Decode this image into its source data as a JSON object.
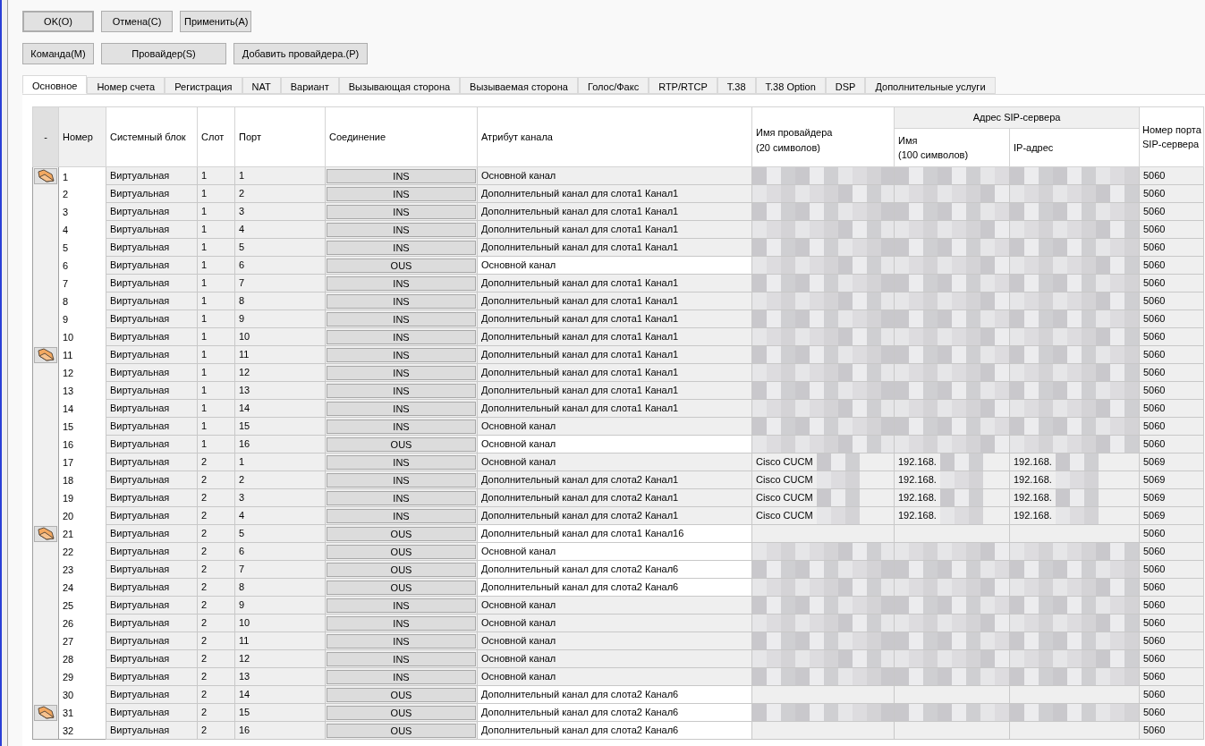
{
  "buttons_top": [
    {
      "label": "OK(O)",
      "default": true
    },
    {
      "label": "Отмена(C)",
      "default": false
    },
    {
      "label": "Применить(A)",
      "default": false
    }
  ],
  "buttons_second": [
    {
      "label": "Команда(M)"
    },
    {
      "label": "Провайдер(S)"
    },
    {
      "label": "Добавить провайдера.(P)"
    }
  ],
  "tabs": [
    {
      "label": "Основное",
      "selected": true
    },
    {
      "label": "Номер счета",
      "selected": false
    },
    {
      "label": "Регистрация",
      "selected": false
    },
    {
      "label": "NAT",
      "selected": false
    },
    {
      "label": "Вариант",
      "selected": false
    },
    {
      "label": "Вызывающая сторона",
      "selected": false
    },
    {
      "label": "Вызываемая сторона",
      "selected": false
    },
    {
      "label": "Голос/Факс",
      "selected": false
    },
    {
      "label": "RTP/RTCP",
      "selected": false
    },
    {
      "label": "T.38",
      "selected": false
    },
    {
      "label": "T.38 Option",
      "selected": false
    },
    {
      "label": "DSP",
      "selected": false
    },
    {
      "label": "Дополнительные услуги",
      "selected": false
    }
  ],
  "table": {
    "columns": [
      "-",
      "Номер",
      "Системный блок",
      "Слот",
      "Порт",
      "Соединение",
      "Атрибут канала",
      "Имя провайдера\n(20 символов)"
    ],
    "group_header": "Адрес SIP-сервера",
    "group_columns": [
      "Имя\n(100 символов)",
      "IP-адрес"
    ],
    "last_column": "Номер порта\nSIP-сервера",
    "rows": [
      {
        "marker": true,
        "number": "1",
        "block": "Виртуальная",
        "slot": "1",
        "port": "1",
        "connection": "INS",
        "attribute": "Основной канал",
        "redacted": true,
        "sip_port": "5060"
      },
      {
        "marker": false,
        "number": "2",
        "block": "Виртуальная",
        "slot": "1",
        "port": "2",
        "connection": "INS",
        "attribute": "Дополнительный канал для слота1 Канал1",
        "redacted": true,
        "sip_port": "5060"
      },
      {
        "marker": false,
        "number": "3",
        "block": "Виртуальная",
        "slot": "1",
        "port": "3",
        "connection": "INS",
        "attribute": "Дополнительный канал для слота1 Канал1",
        "redacted": true,
        "sip_port": "5060"
      },
      {
        "marker": false,
        "number": "4",
        "block": "Виртуальная",
        "slot": "1",
        "port": "4",
        "connection": "INS",
        "attribute": "Дополнительный канал для слота1 Канал1",
        "redacted": true,
        "sip_port": "5060"
      },
      {
        "marker": false,
        "number": "5",
        "block": "Виртуальная",
        "slot": "1",
        "port": "5",
        "connection": "INS",
        "attribute": "Дополнительный канал для слота1 Канал1",
        "redacted": true,
        "sip_port": "5060"
      },
      {
        "marker": false,
        "number": "6",
        "block": "Виртуальная",
        "slot": "1",
        "port": "6",
        "connection": "OUS",
        "attribute": "Основной канал",
        "redacted": true,
        "sip_port": "5060"
      },
      {
        "marker": false,
        "number": "7",
        "block": "Виртуальная",
        "slot": "1",
        "port": "7",
        "connection": "INS",
        "attribute": "Дополнительный канал для слота1 Канал1",
        "redacted": true,
        "sip_port": "5060"
      },
      {
        "marker": false,
        "number": "8",
        "block": "Виртуальная",
        "slot": "1",
        "port": "8",
        "connection": "INS",
        "attribute": "Дополнительный канал для слота1 Канал1",
        "redacted": true,
        "sip_port": "5060"
      },
      {
        "marker": false,
        "number": "9",
        "block": "Виртуальная",
        "slot": "1",
        "port": "9",
        "connection": "INS",
        "attribute": "Дополнительный канал для слота1 Канал1",
        "redacted": true,
        "sip_port": "5060"
      },
      {
        "marker": false,
        "number": "10",
        "block": "Виртуальная",
        "slot": "1",
        "port": "10",
        "connection": "INS",
        "attribute": "Дополнительный канал для слота1 Канал1",
        "redacted": true,
        "sip_port": "5060"
      },
      {
        "marker": true,
        "number": "11",
        "block": "Виртуальная",
        "slot": "1",
        "port": "11",
        "connection": "INS",
        "attribute": "Дополнительный канал для слота1 Канал1",
        "redacted": true,
        "sip_port": "5060"
      },
      {
        "marker": false,
        "number": "12",
        "block": "Виртуальная",
        "slot": "1",
        "port": "12",
        "connection": "INS",
        "attribute": "Дополнительный канал для слота1 Канал1",
        "redacted": true,
        "sip_port": "5060"
      },
      {
        "marker": false,
        "number": "13",
        "block": "Виртуальная",
        "slot": "1",
        "port": "13",
        "connection": "INS",
        "attribute": "Дополнительный канал для слота1 Канал1",
        "redacted": true,
        "sip_port": "5060"
      },
      {
        "marker": false,
        "number": "14",
        "block": "Виртуальная",
        "slot": "1",
        "port": "14",
        "connection": "INS",
        "attribute": "Дополнительный канал для слота1 Канал1",
        "redacted": true,
        "sip_port": "5060"
      },
      {
        "marker": false,
        "number": "15",
        "block": "Виртуальная",
        "slot": "1",
        "port": "15",
        "connection": "INS",
        "attribute": "Основной канал",
        "redacted": true,
        "sip_port": "5060"
      },
      {
        "marker": false,
        "number": "16",
        "block": "Виртуальная",
        "slot": "1",
        "port": "16",
        "connection": "OUS",
        "attribute": "Основной канал",
        "redacted": true,
        "sip_port": "5060"
      },
      {
        "marker": false,
        "number": "17",
        "block": "Виртуальная",
        "slot": "2",
        "port": "1",
        "connection": "INS",
        "attribute": "Основной канал",
        "provider": "Cisco CUCM",
        "sip_name": "192.168.",
        "sip_ip": "192.168.",
        "redacted": true,
        "sip_port": "5069"
      },
      {
        "marker": false,
        "number": "18",
        "block": "Виртуальная",
        "slot": "2",
        "port": "2",
        "connection": "INS",
        "attribute": "Дополнительный канал для слота2 Канал1",
        "provider": "Cisco CUCM",
        "sip_name": "192.168.",
        "sip_ip": "192.168.",
        "redacted": true,
        "sip_port": "5069"
      },
      {
        "marker": false,
        "number": "19",
        "block": "Виртуальная",
        "slot": "2",
        "port": "3",
        "connection": "INS",
        "attribute": "Дополнительный канал для слота2 Канал1",
        "provider": "Cisco CUCM",
        "sip_name": "192.168.",
        "sip_ip": "192.168.",
        "redacted": true,
        "sip_port": "5069"
      },
      {
        "marker": false,
        "number": "20",
        "block": "Виртуальная",
        "slot": "2",
        "port": "4",
        "connection": "INS",
        "attribute": "Дополнительный канал для слота2 Канал1",
        "provider": "Cisco CUCM",
        "sip_name": "192.168.",
        "sip_ip": "192.168.",
        "redacted": true,
        "sip_port": "5069"
      },
      {
        "marker": true,
        "number": "21",
        "block": "Виртуальная",
        "slot": "2",
        "port": "5",
        "connection": "OUS",
        "attribute": "Дополнительный канал для слота1 Канал16",
        "redacted": false,
        "sip_port": "5060"
      },
      {
        "marker": false,
        "number": "22",
        "block": "Виртуальная",
        "slot": "2",
        "port": "6",
        "connection": "OUS",
        "attribute": "Основной канал",
        "redacted": true,
        "sip_port": "5060"
      },
      {
        "marker": false,
        "number": "23",
        "block": "Виртуальная",
        "slot": "2",
        "port": "7",
        "connection": "OUS",
        "attribute": "Дополнительный канал для слота2 Канал6",
        "redacted": true,
        "sip_port": "5060"
      },
      {
        "marker": false,
        "number": "24",
        "block": "Виртуальная",
        "slot": "2",
        "port": "8",
        "connection": "OUS",
        "attribute": "Дополнительный канал для слота2 Канал6",
        "redacted": true,
        "sip_port": "5060"
      },
      {
        "marker": false,
        "number": "25",
        "block": "Виртуальная",
        "slot": "2",
        "port": "9",
        "connection": "INS",
        "attribute": "Основной канал",
        "redacted": true,
        "sip_port": "5060"
      },
      {
        "marker": false,
        "number": "26",
        "block": "Виртуальная",
        "slot": "2",
        "port": "10",
        "connection": "INS",
        "attribute": "Основной канал",
        "redacted": true,
        "sip_port": "5060"
      },
      {
        "marker": false,
        "number": "27",
        "block": "Виртуальная",
        "slot": "2",
        "port": "11",
        "connection": "INS",
        "attribute": "Основной канал",
        "redacted": true,
        "sip_port": "5060"
      },
      {
        "marker": false,
        "number": "28",
        "block": "Виртуальная",
        "slot": "2",
        "port": "12",
        "connection": "INS",
        "attribute": "Основной канал",
        "redacted": true,
        "sip_port": "5060"
      },
      {
        "marker": false,
        "number": "29",
        "block": "Виртуальная",
        "slot": "2",
        "port": "13",
        "connection": "INS",
        "attribute": "Основной канал",
        "redacted": true,
        "sip_port": "5060"
      },
      {
        "marker": false,
        "number": "30",
        "block": "Виртуальная",
        "slot": "2",
        "port": "14",
        "connection": "OUS",
        "attribute": "Дополнительный канал для слота2 Канал6",
        "redacted": false,
        "sip_port": "5060"
      },
      {
        "marker": true,
        "number": "31",
        "block": "Виртуальная",
        "slot": "2",
        "port": "15",
        "connection": "OUS",
        "attribute": "Дополнительный канал для слота2 Канал6",
        "redacted": true,
        "sip_port": "5060"
      },
      {
        "marker": false,
        "number": "32",
        "block": "Виртуальная",
        "slot": "2",
        "port": "16",
        "connection": "OUS",
        "attribute": "Дополнительный канал для слота2 Канал6",
        "redacted": false,
        "sip_port": "5060"
      }
    ]
  }
}
